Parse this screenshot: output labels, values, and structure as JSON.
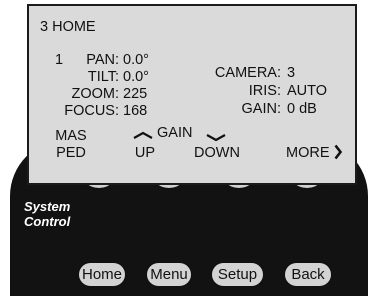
{
  "screen": {
    "title": "3 HOME",
    "channel": "1",
    "readouts": [
      {
        "label": "PAN:",
        "value": "0.0°"
      },
      {
        "label": "TILT:",
        "value": "0.0°"
      },
      {
        "label": "ZOOM:",
        "value": "225"
      },
      {
        "label": "FOCUS:",
        "value": "168"
      }
    ],
    "camera_params": [
      {
        "label": "CAMERA:",
        "value": "3"
      },
      {
        "label": "IRIS:",
        "value": "AUTO"
      },
      {
        "label": "GAIN:",
        "value": "0 dB"
      }
    ],
    "softkeys": {
      "mas_ped_top": "MAS",
      "mas_ped_bottom": "PED",
      "gain_label": "GAIN",
      "up": "UP",
      "down": "DOWN",
      "more": "MORE"
    }
  },
  "panel": {
    "brand_line1": "System",
    "brand_line2": "Control",
    "buttons": [
      "Home",
      "Menu",
      "Setup",
      "Back"
    ]
  },
  "icons": {
    "gain_up": "chevron-up-icon",
    "gain_down": "chevron-down-icon",
    "more": "chevron-right-icon"
  }
}
